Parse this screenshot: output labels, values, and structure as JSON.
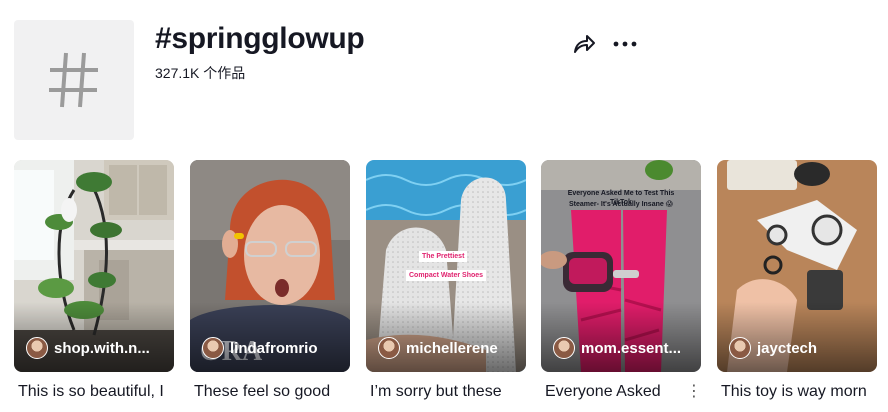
{
  "header": {
    "hashtag_icon": "hashtag-icon",
    "title": "#springglowup",
    "count": "327.1K 个作品",
    "share_icon": "share-icon",
    "more_icon": "more-horizontal-icon"
  },
  "videos": [
    {
      "author": "shop.with.n...",
      "caption": "This is so beautiful, I"
    },
    {
      "author": "lindafromrio",
      "caption": "These feel so good"
    },
    {
      "author": "michellerene",
      "caption": "I’m sorry but these",
      "overlay": [
        "The Prettiest",
        "Compact Water Shoes"
      ]
    },
    {
      "author": "mom.essent...",
      "caption": "Everyone Asked",
      "overlay": [
        "Everyone Asked Me to Test This TikTok",
        "Steamer- It's Actually Insane 😱"
      ]
    },
    {
      "author": "jayctech",
      "caption": "This toy is way morn"
    }
  ],
  "card_menu_icon": "kebab-menu-icon",
  "colors": {
    "text": "#161823",
    "tile_bg": "#f1f1f2",
    "overlay_pink": "#e0236f"
  }
}
